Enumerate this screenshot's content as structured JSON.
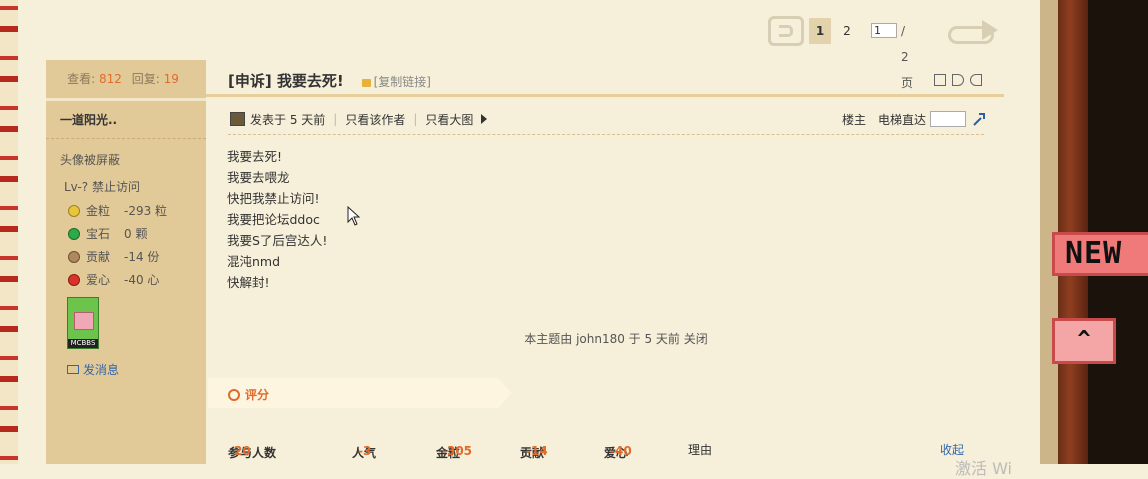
{
  "pager": {
    "current": "1",
    "page2": "2",
    "input_value": "1",
    "total": "/ 2 页"
  },
  "sidebar": {
    "views_label": "查看:",
    "views": "812",
    "replies_label": "回复:",
    "replies": "19",
    "author": "一道阳光..",
    "avatar_note": "头像被屏蔽",
    "level": "Lv-? 禁止访问",
    "stats": [
      {
        "icon": "gold-icon",
        "color": "#e8c63a",
        "label": "金粒",
        "value": "-293 粒"
      },
      {
        "icon": "gem-icon",
        "color": "#2faa4a",
        "label": "宝石",
        "value": "0 颗"
      },
      {
        "icon": "contribution-icon",
        "color": "#b08860",
        "label": "贡献",
        "value": "-14 份"
      },
      {
        "icon": "heart-icon",
        "color": "#d8322a",
        "label": "爱心",
        "value": "-40 心"
      }
    ],
    "medal_text": "MCBBS",
    "send_message": "发消息"
  },
  "post": {
    "title": "[申诉] 我要去死!",
    "copy_link": "[复制链接]",
    "posted": "发表于 5 天前",
    "author_only": "只看该作者",
    "big_images": "只看大图",
    "floor": "楼主",
    "elevator": "电梯直达",
    "lines": [
      "我要去死!",
      "我要去喂龙",
      "快把我禁止访问!",
      "我要把论坛ddoc",
      "我要S了后宫达人!",
      "混沌nmd",
      "快解封!"
    ],
    "closed_note": "本主题由 john180 于 5 天前 关闭"
  },
  "rating": {
    "label": "评分",
    "participants_label": "参与人数",
    "participants": "20",
    "popularity_label": "人气",
    "popularity": "-3",
    "gold_label": "金粒",
    "gold": "-305",
    "contrib_label": "贡献",
    "contrib": "-14",
    "love_label": "爱心",
    "love": "-40",
    "reason_label": "理由",
    "collapse": "收起"
  },
  "badges": {
    "new": "NEW",
    "up": "^"
  },
  "watermark": "激活 Wi"
}
